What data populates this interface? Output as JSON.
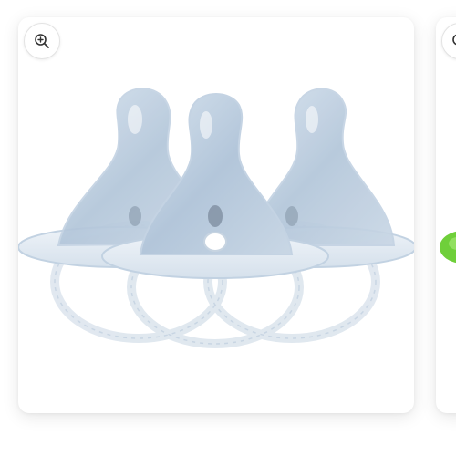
{
  "gallery": {
    "active_card": {
      "zoom_icon": "zoom-in-icon",
      "image_subject": "three-clear-silicone-nipples"
    },
    "next_card": {
      "zoom_icon": "zoom-in-icon",
      "accent_color": "#6fcf3a"
    }
  },
  "colors": {
    "card_background": "#ffffff",
    "silicone_tint": "#b9cde0",
    "icon_stroke": "#333333"
  }
}
